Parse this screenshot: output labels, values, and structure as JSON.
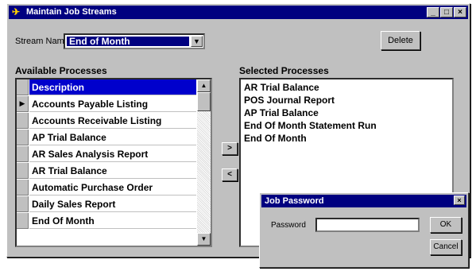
{
  "window": {
    "title": "Maintain Job Streams",
    "controls": {
      "minimize": "_",
      "maximize": "□",
      "close": "×"
    }
  },
  "stream": {
    "label": "Stream Name",
    "value": "End of Month"
  },
  "buttons": {
    "delete": "Delete",
    "add": ">",
    "remove": "<"
  },
  "available": {
    "label": "Available Processes",
    "header": "Description",
    "current_row_marker": "▶",
    "items": [
      "Accounts Payable Listing",
      "Accounts Receivable Listing",
      "AP Trial Balance",
      "AR Sales Analysis Report",
      "AR Trial Balance",
      "Automatic Purchase Order",
      "Daily Sales Report",
      "End Of Month"
    ]
  },
  "selected": {
    "label": "Selected Processes",
    "items": [
      "AR Trial Balance",
      "POS Journal Report",
      "AP Trial Balance",
      "End Of Month Statement Run",
      "End Of Month"
    ]
  },
  "dialog": {
    "title": "Job Password",
    "close": "×",
    "password_label": "Password",
    "password_value": "",
    "ok": "OK",
    "cancel": "Cancel"
  },
  "colors": {
    "titlebar": "#000080",
    "window_bg": "#c0c0c0",
    "selection": "#0000cc"
  }
}
